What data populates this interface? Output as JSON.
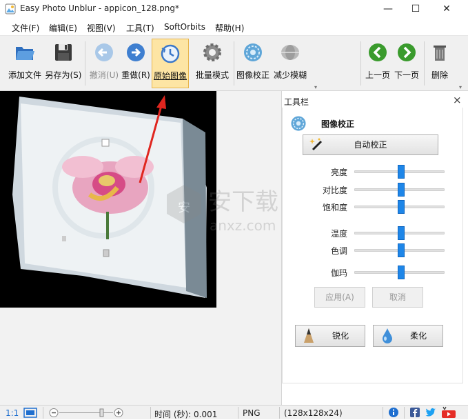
{
  "window": {
    "title": "Easy Photo Unblur - appicon_128.png*",
    "minimize": "—",
    "maximize": "☐",
    "close": "✕"
  },
  "menu": [
    "文件(F)",
    "编辑(E)",
    "视图(V)",
    "工具(T)",
    "SoftOrbits",
    "帮助(H)"
  ],
  "toolbar": {
    "add_file": "添加文件",
    "save_as": "另存为(S)",
    "undo": "撤消(U)",
    "redo": "重做(R)",
    "original": "原始图像",
    "batch": "批量模式",
    "correction": "图像校正",
    "reduce_blur": "减少模糊",
    "prev": "上一页",
    "next": "下一页",
    "delete": "删除"
  },
  "tool_panel": {
    "title": "工具栏",
    "close": "×",
    "section_title": "图像校正",
    "auto_button": "自动校正",
    "sliders": [
      {
        "label": "亮度",
        "value": 0.5
      },
      {
        "label": "对比度",
        "value": 0.5
      },
      {
        "label": "饱和度",
        "value": 0.5
      },
      {
        "label": "温度",
        "value": 0.5
      },
      {
        "label": "色调",
        "value": 0.5
      },
      {
        "label": "伽玛",
        "value": 0.5
      }
    ],
    "apply": "应用(A)",
    "cancel": "取消",
    "sharpen": "锐化",
    "soften": "柔化"
  },
  "status": {
    "zoom_fit": "1:1",
    "time": "时间 (秒): 0.001",
    "format": "PNG",
    "size": "(128x128x24)"
  },
  "colors": {
    "accent_blue": "#1e86e8",
    "active_button": "#fde5a4",
    "nav_green": "#3a9b2d",
    "arrow_red": "#e0261f"
  }
}
